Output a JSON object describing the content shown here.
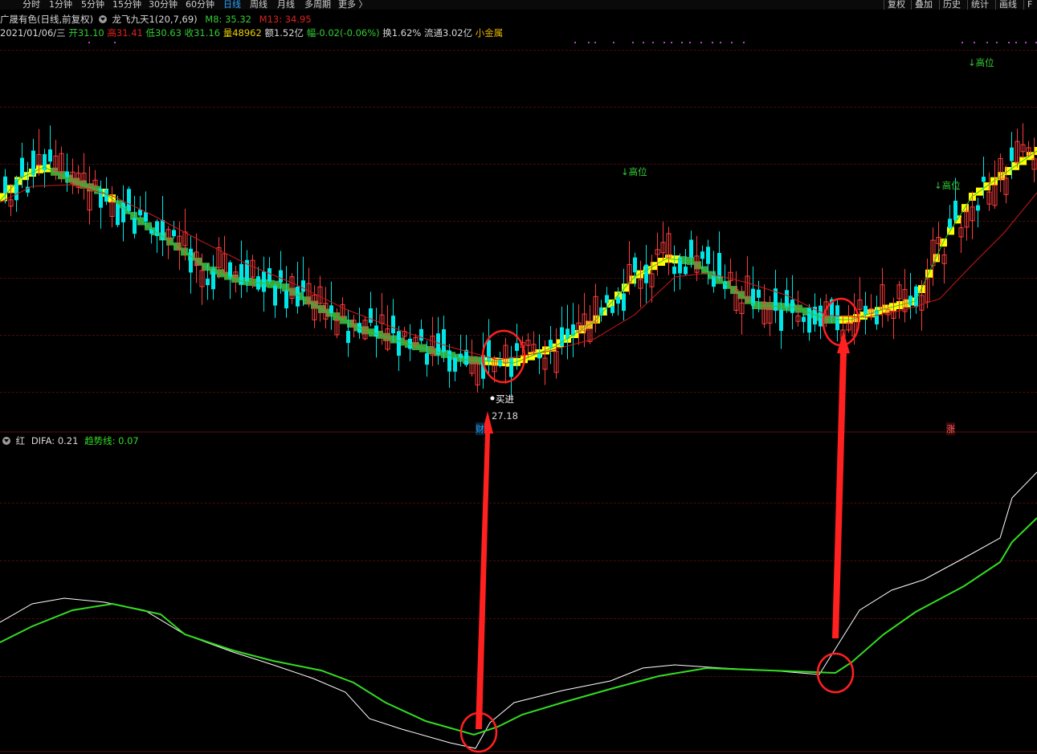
{
  "toolbar": {
    "timeframes": [
      "分时",
      "1分钟",
      "5分钟",
      "15分钟",
      "30分钟",
      "60分钟",
      "日线",
      "周线",
      "月线",
      "多周期",
      "更多 〉"
    ],
    "active_timeframe": "日线",
    "right_buttons": [
      "复权",
      "叠加",
      "历史",
      "统计",
      "画线",
      "F"
    ]
  },
  "header": {
    "stock_name": "广晟有色(日线,前复权)",
    "indicator_name": "龙飞九天1(20,7,69)",
    "m8_label": "M8: 35.32",
    "m13_label": "M13: 34.95"
  },
  "quote": {
    "date": "2021/01/06/三",
    "open": "开31.10",
    "high": "高31.41",
    "low": "低30.63",
    "close": "收31.16",
    "volume": "量48962",
    "amount": "额1.52亿",
    "amplitude": "幅-0.02(-0.06%)",
    "turnover": "换1.62%",
    "float_cap": "流通3.02亿",
    "tag": "小金属"
  },
  "annotations": {
    "high_labels": [
      "↓高位",
      "↓高位",
      "↓高位"
    ],
    "buy_label": "买进",
    "low_price": "27.18",
    "event_fin": "财",
    "event_up": "涨"
  },
  "sub_indicator": {
    "name": "红",
    "difa_label": "DIFA: 0.21",
    "trend_label": "趋势线: 0.07"
  },
  "colors": {
    "up": "#ff3c3c",
    "down": "#00e5e5",
    "ma_fast": "#33cc33",
    "ma_slow": "#e02020",
    "band_up": "#ffff00",
    "band_down": "#3aa63a",
    "difa": "#ffffff",
    "trend": "#33dd22",
    "arrow": "#ff2020",
    "accent_blue": "#2aa6ff"
  },
  "icons": [
    "indicator-dropdown-icon",
    "sub-indicator-dropdown-icon",
    "buy-dot-icon"
  ]
}
